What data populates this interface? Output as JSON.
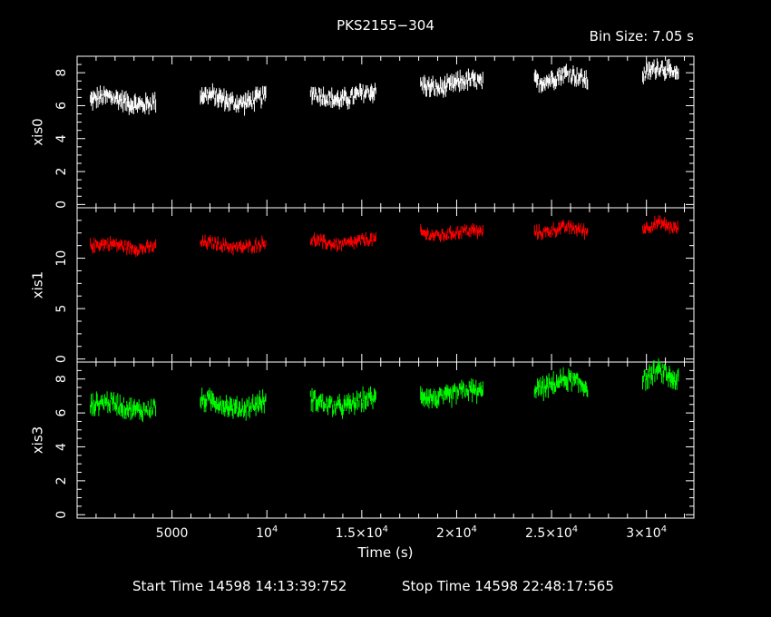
{
  "chart_data": {
    "type": "scatter",
    "title": "PKS2155−304",
    "bin_size": "Bin Size: 7.05 s",
    "xlabel": "Time (s)",
    "xlim": [
      0,
      32500
    ],
    "x_ticks": [
      {
        "value": 5000,
        "label": "5000"
      },
      {
        "value": 10000,
        "label": "10",
        "exp": "4"
      },
      {
        "value": 15000,
        "label": "1.5×10",
        "exp": "4"
      },
      {
        "value": 20000,
        "label": "2×10",
        "exp": "4"
      },
      {
        "value": 25000,
        "label": "2.5×10",
        "exp": "4"
      },
      {
        "value": 30000,
        "label": "3×10",
        "exp": "4"
      }
    ],
    "segments": [
      [
        700,
        4150
      ],
      [
        6500,
        9950
      ],
      [
        12300,
        15750
      ],
      [
        18100,
        21400
      ],
      [
        24100,
        26900
      ],
      [
        29800,
        31700
      ]
    ],
    "series": [
      {
        "name": "xis0",
        "color": "#ffffff",
        "ylabel": "xis0",
        "ylim": [
          -0.2,
          9.0
        ],
        "yticks": [
          0,
          2,
          4,
          6,
          8
        ],
        "segment_levels": [
          6.3,
          6.4,
          6.6,
          7.3,
          7.7,
          8.1
        ],
        "noise": 0.55
      },
      {
        "name": "xis1",
        "color": "#ff0000",
        "ylabel": "xis1",
        "ylim": [
          -0.3,
          15.0
        ],
        "yticks": [
          0,
          5,
          10
        ],
        "segment_levels": [
          11.2,
          11.3,
          11.6,
          12.5,
          12.8,
          13.2
        ],
        "noise": 0.6
      },
      {
        "name": "xis3",
        "color": "#00ff00",
        "ylabel": "xis3",
        "ylim": [
          -0.2,
          9.0
        ],
        "yticks": [
          0,
          2,
          4,
          6,
          8
        ],
        "segment_levels": [
          6.4,
          6.5,
          6.6,
          7.1,
          7.7,
          8.2
        ],
        "noise": 0.55
      }
    ],
    "grid": false,
    "footer": {
      "start": "Start Time 14598 14:13:39:752",
      "stop": "Stop Time 14598 22:48:17:565"
    }
  }
}
